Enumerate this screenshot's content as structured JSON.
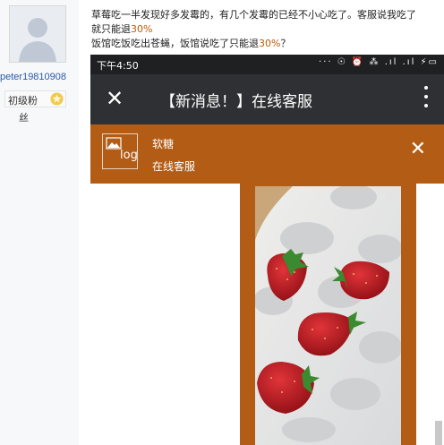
{
  "author": {
    "username": "peter19810908",
    "rank": "初级粉",
    "rank_continued": "丝",
    "avatar_icon": "default-user-icon",
    "rank_icon": "star-icon"
  },
  "post": {
    "line1": "草莓吃一半发现好多发霉的，有几个发霉的已经不小心吃了。客服说我吃了",
    "line2_prefix": "就只能退",
    "line2_highlight": "30%",
    "line3_prefix": "饭馆吃饭吃出苍蝇，饭馆说吃了只能退",
    "line3_highlight": "30%",
    "line3_suffix": "？",
    "highlight_color": "#c05a00"
  },
  "phone": {
    "status_time": "下午4:50",
    "status_icons": "···  ☉ ⏰ ⁂ .ıl .ıl ⚡▭",
    "title": "【新消息！】在线客服",
    "close_icon": "close-icon",
    "menu_icon": "more-vertical-icon",
    "banner": {
      "thumb_text": "log",
      "name": "软糖",
      "subtitle": "在线客服",
      "close_icon": "close-icon"
    },
    "accent_color": "#b25c16",
    "titlebar_color": "#2f3033"
  }
}
